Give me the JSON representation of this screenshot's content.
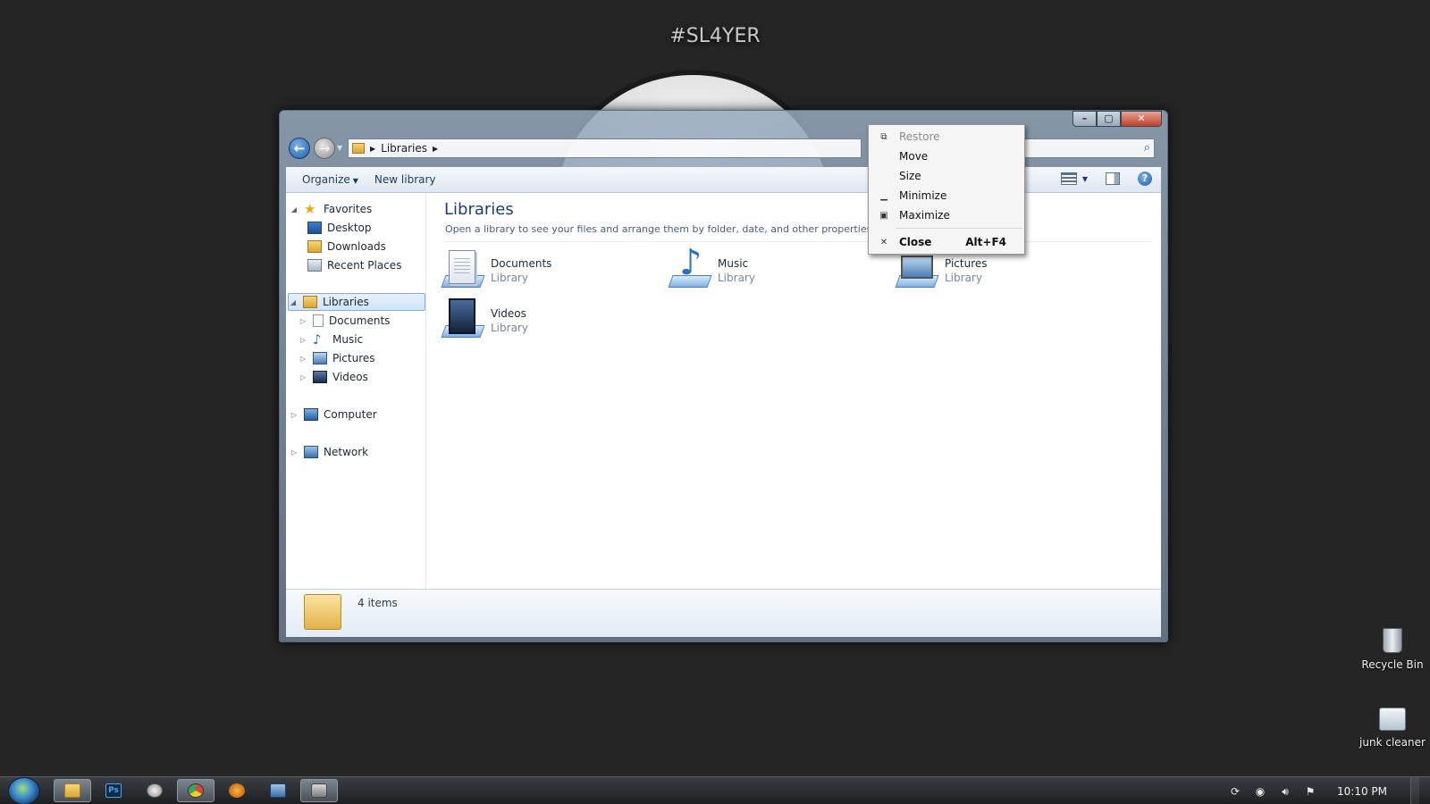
{
  "wallpaper": {
    "title": "#SL4YER"
  },
  "window": {
    "caption_buttons": {
      "minimize": "–",
      "maximize": "▢",
      "close": "✕"
    },
    "address": {
      "segments": [
        "Libraries"
      ]
    },
    "toolbar": {
      "organize": "Organize",
      "new_library": "New library"
    },
    "nav_pane": {
      "favorites": {
        "label": "Favorites",
        "items": [
          "Desktop",
          "Downloads",
          "Recent Places"
        ]
      },
      "libraries": {
        "label": "Libraries",
        "items": [
          "Documents",
          "Music",
          "Pictures",
          "Videos"
        ]
      },
      "computer": "Computer",
      "network": "Network"
    },
    "content": {
      "title": "Libraries",
      "subtitle": "Open a library to see your files and arrange them by folder, date, and other properties.",
      "libraries": [
        {
          "name": "Documents",
          "type": "Library",
          "icon": "documents-library-icon"
        },
        {
          "name": "Music",
          "type": "Library",
          "icon": "music-library-icon"
        },
        {
          "name": "Pictures",
          "type": "Library",
          "icon": "pictures-library-icon"
        },
        {
          "name": "Videos",
          "type": "Library",
          "icon": "videos-library-icon"
        }
      ]
    },
    "details": {
      "count": "4 items"
    }
  },
  "context_menu": {
    "items": [
      {
        "label": "Restore",
        "enabled": false,
        "icon": "restore-icon"
      },
      {
        "label": "Move",
        "enabled": true
      },
      {
        "label": "Size",
        "enabled": true
      },
      {
        "label": "Minimize",
        "enabled": true,
        "icon": "minimize-icon"
      },
      {
        "label": "Maximize",
        "enabled": true,
        "icon": "maximize-icon"
      },
      {
        "label": "Close",
        "enabled": true,
        "icon": "close-icon",
        "shortcut": "Alt+F4",
        "bold": true
      }
    ]
  },
  "desktop_icons": [
    {
      "label": "Recycle Bin",
      "icon": "recycle-bin-icon"
    },
    {
      "label": "junk cleaner",
      "icon": "junk-cleaner-icon"
    }
  ],
  "taskbar": {
    "apps": [
      "Windows Explorer",
      "Photoshop",
      "Application",
      "Chrome",
      "Application",
      "Application",
      "Application"
    ],
    "ps_glyph": "Ps",
    "clock": "10:10 PM"
  }
}
